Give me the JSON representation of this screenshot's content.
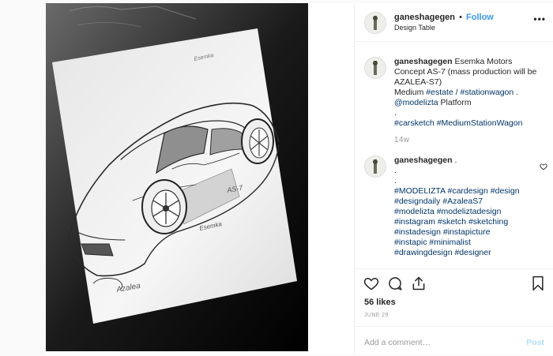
{
  "header": {
    "username": "ganeshagegen",
    "separator": "•",
    "follow_label": "Follow",
    "location": "Design Table",
    "more_label": "•••"
  },
  "caption": {
    "username": "ganeshagegen",
    "text_1": "Esemka Motors Concept AS-7 (mass production will be AZALEA-S7)",
    "text_2_prefix": "Medium",
    "tag_estate": "#estate",
    "slash": "/",
    "tag_stationwagon": "#stationwagon",
    "period": ".",
    "mention": "@modelizta",
    "text_3_suffix": "Platform",
    "line_dot": ".",
    "tags_line": "#carsketch #MediumStationWagon",
    "time": "14w"
  },
  "comment": {
    "username": "ganeshagegen",
    "first_text": ".",
    "dot1": ".",
    "dot2": ".",
    "tags": [
      "#MODELIZTA #cardesign #design",
      "#designdaily #AzaleaS7",
      "#modelizta #modeliztadesign",
      "#instagram #sketch #sketching",
      "#instadesign #instapicture",
      "#instapic #minimalist",
      "#drawingdesign #designer"
    ]
  },
  "actions": {
    "likes": "56 likes",
    "date": "JUNE 29",
    "comment_placeholder": "Add a comment…",
    "post_label": "Post"
  },
  "photo": {
    "sketch_labels": [
      "Azalea",
      "AS-7",
      "Esemka"
    ]
  }
}
